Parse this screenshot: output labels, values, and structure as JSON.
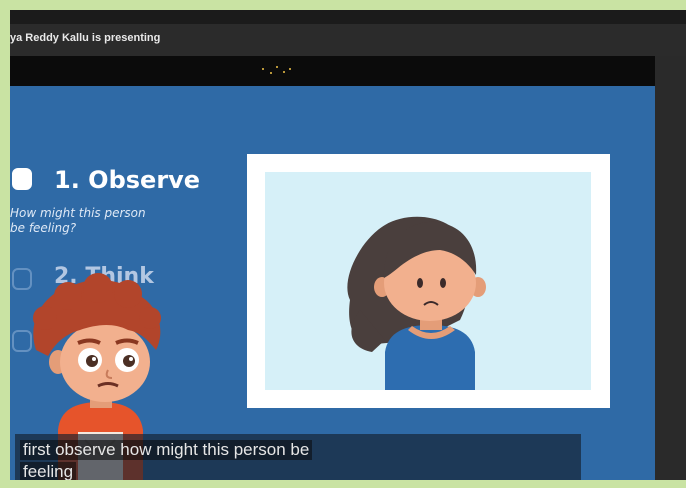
{
  "header": {
    "presenting_text": "ya Reddy Kallu is presenting"
  },
  "slide": {
    "steps": [
      {
        "label": "1. Observe",
        "prompt_line1": "How might this person",
        "prompt_line2": "be feeling?",
        "checked": true
      },
      {
        "label": "2. Think",
        "checked": false
      },
      {
        "label": "",
        "checked": false
      }
    ],
    "image_subject": "sad-girl-illustration",
    "narrator": "boy-character-illustration"
  },
  "caption": {
    "line1": "first observe how might this person be",
    "line2": "feeling"
  },
  "colors": {
    "slide_bg": "#2f6aa6",
    "card_bg": "#ffffff",
    "card_inner_bg": "#d6f0f8",
    "header_bg": "#2b2b2b"
  }
}
